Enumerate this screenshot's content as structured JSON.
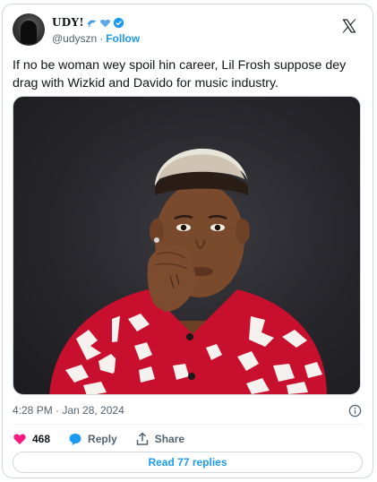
{
  "author": {
    "display_name": "𝐔𝐃𝐘!",
    "emoji_1": "dolphin-emoji",
    "emoji_2": "blue-heart-emoji",
    "verified": "verified-badge-icon",
    "handle": "@udyszn",
    "separator": "·",
    "follow_label": "Follow"
  },
  "tweet": {
    "text": "If no be woman wey spoil hin career, Lil Frosh suppose dey drag with Wizkid and Davido for music industry.",
    "timestamp": "4:28 PM · Jan 28, 2024"
  },
  "actions": {
    "like_count": "468",
    "reply_label": "Reply",
    "share_label": "Share"
  },
  "read_replies": "Read 77 replies",
  "colors": {
    "accent": "#1d9bf0",
    "like": "#f91880",
    "shirt_red": "#c8102e"
  }
}
